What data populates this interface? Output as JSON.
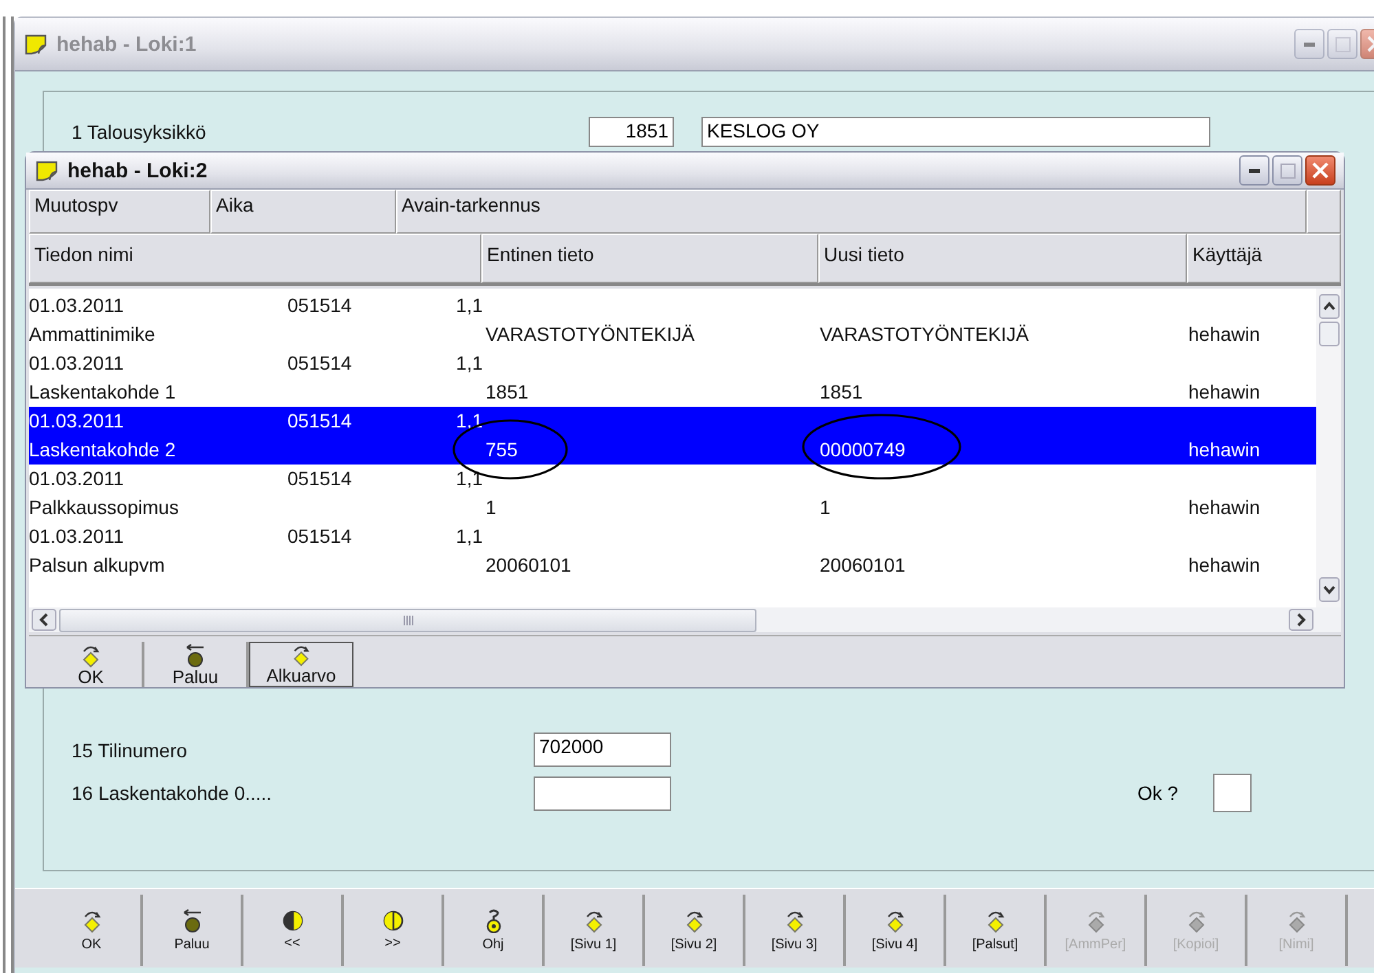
{
  "back_window": {
    "title": "hehab - Loki:1",
    "active": false,
    "top_field": {
      "label": "1 Talousyksikkö",
      "code": "1851",
      "name": "KESLOG OY"
    },
    "fields": [
      {
        "label": "15 Tilinumero",
        "value": "702000"
      },
      {
        "label": "16 Laskentakohde 0....."
      }
    ],
    "confirm": {
      "label": "Ok ?",
      "checked": false
    },
    "toolbar": [
      {
        "label": "OK",
        "kind": "confirm",
        "disabled": false
      },
      {
        "label": "Paluu",
        "kind": "back",
        "disabled": false
      },
      {
        "label": "<<",
        "kind": "prev",
        "disabled": false
      },
      {
        "label": ">>",
        "kind": "next",
        "disabled": false
      },
      {
        "label": "Ohj",
        "kind": "help",
        "disabled": false
      },
      {
        "label": "[Sivu 1]",
        "kind": "confirm",
        "disabled": false
      },
      {
        "label": "[Sivu 2]",
        "kind": "confirm",
        "disabled": false
      },
      {
        "label": "[Sivu 3]",
        "kind": "confirm",
        "disabled": false
      },
      {
        "label": "[Sivu 4]",
        "kind": "confirm",
        "disabled": false
      },
      {
        "label": "[Palsut]",
        "kind": "confirm",
        "disabled": false
      },
      {
        "label": "[AmmPer]",
        "kind": "confirm",
        "disabled": true
      },
      {
        "label": "[Kopioi]",
        "kind": "confirm",
        "disabled": true
      },
      {
        "label": "[Nimi]",
        "kind": "confirm",
        "disabled": true
      }
    ]
  },
  "front_window": {
    "title": "hehab - Loki:2",
    "active": true,
    "header_top": [
      "Muutospv",
      "Aika",
      "Avain-tarkennus"
    ],
    "columns": [
      "Tiedon nimi",
      "Entinen tieto",
      "Uusi tieto",
      "Käyttäjä"
    ],
    "rows": [
      {
        "date": "01.03.2011",
        "time": "051514",
        "code": "1,1",
        "name": "Ammattinimike",
        "old": "VARASTOTYÖNTEKIJÄ",
        "new": "VARASTOTYÖNTEKIJÄ",
        "user": "hehawin",
        "selected": false,
        "circled": false
      },
      {
        "date": "01.03.2011",
        "time": "051514",
        "code": "1,1",
        "name": "Laskentakohde 1",
        "old": "1851",
        "new": "1851",
        "user": "hehawin",
        "selected": false,
        "circled": false
      },
      {
        "date": "01.03.2011",
        "time": "051514",
        "code": "1,1",
        "name": "Laskentakohde 2",
        "old": "755",
        "new": "00000749",
        "user": "hehawin",
        "selected": true,
        "circled": true
      },
      {
        "date": "01.03.2011",
        "time": "051514",
        "code": "1,1",
        "name": "Palkkaussopimus",
        "old": "1",
        "new": "1",
        "user": "hehawin",
        "selected": false,
        "circled": false
      },
      {
        "date": "01.03.2011",
        "time": "051514",
        "code": "1,1",
        "name": "Palsun alkupvm",
        "old": "20060101",
        "new": "20060101",
        "user": "hehawin",
        "selected": false,
        "circled": false
      }
    ],
    "buttons": [
      {
        "label": "OK",
        "kind": "confirm",
        "focused": false
      },
      {
        "label": "Paluu",
        "kind": "back",
        "focused": false
      },
      {
        "label": "Alkuarvo",
        "kind": "confirm",
        "focused": true
      }
    ]
  }
}
